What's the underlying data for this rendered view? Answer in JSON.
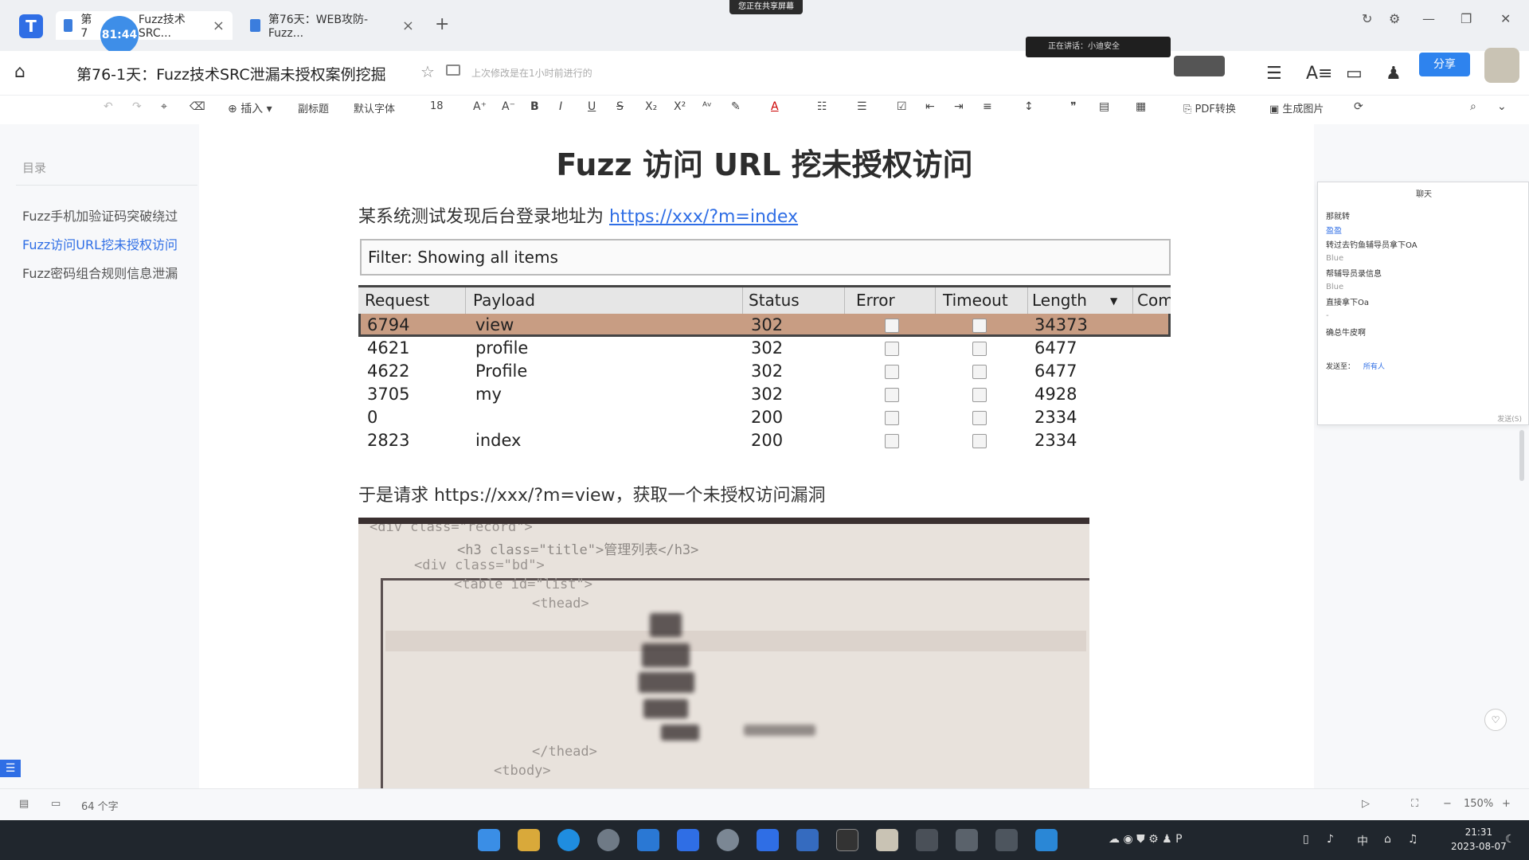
{
  "tabs": [
    {
      "label": "第7",
      "timer": "81:44",
      "label2": "Fuzz技术SRC..."
    },
    {
      "label": "第76天：WEB攻防-Fuzz..."
    }
  ],
  "share_banner": "您正在共享屏幕",
  "header": {
    "doc_title": "第76-1天：Fuzz技术SRC泄漏未授权案例挖掘",
    "save_status": "上次修改是在1小时前进行的",
    "speaker": "正在讲话：小迪安全",
    "share_label": "分享"
  },
  "toolbar": {
    "insert": "插入",
    "heading": "副标题",
    "font": "默认字体",
    "size": "18",
    "pdf": "PDF转换",
    "image": "生成图片"
  },
  "toc": {
    "title": "目录",
    "items": [
      {
        "label": "Fuzz手机加验证码突破绕过",
        "active": false
      },
      {
        "label": "Fuzz访问URL挖未授权访问",
        "active": true
      },
      {
        "label": "Fuzz密码组合规则信息泄漏",
        "active": false
      }
    ]
  },
  "doc": {
    "heading": "Fuzz 访问 URL 挖未授权访问",
    "intro_text": "某系统测试发现后台登录地址为 ",
    "intro_link": "https://xxx/?m=index",
    "result_text": "于是请求 https://xxx/?m=view，获取一个未授权访问漏洞"
  },
  "burp": {
    "filter": "Filter: Showing all items",
    "columns": [
      "Request",
      "Payload",
      "Status",
      "Error",
      "Timeout",
      "Length",
      "Com"
    ],
    "rows": [
      {
        "request": "6794",
        "payload": "view",
        "status": "302",
        "length": "34373",
        "selected": true
      },
      {
        "request": "4621",
        "payload": "profile",
        "status": "302",
        "length": "6477",
        "selected": false
      },
      {
        "request": "4622",
        "payload": "Profile",
        "status": "302",
        "length": "6477",
        "selected": false
      },
      {
        "request": "3705",
        "payload": "my",
        "status": "302",
        "length": "4928",
        "selected": false
      },
      {
        "request": "0",
        "payload": "",
        "status": "200",
        "length": "2334",
        "selected": false
      },
      {
        "request": "2823",
        "payload": "index",
        "status": "200",
        "length": "2334",
        "selected": false
      }
    ]
  },
  "code": {
    "lines": [
      "<div class=\"record\">",
      "<h3 class=\"title\">管理列表</h3>",
      "<div class=\"bd\">",
      "<table id=\"list\">",
      "<thead>",
      "</thead>",
      "<tbody>"
    ]
  },
  "chat": {
    "title": "聊天",
    "messages": [
      {
        "text": "那就转",
        "kind": "text"
      },
      {
        "text": "盈盈",
        "kind": "blue"
      },
      {
        "text": "转过去钓鱼辅导员拿下OA",
        "kind": "text"
      },
      {
        "text": "Blue",
        "kind": "name"
      },
      {
        "text": "帮辅导员录信息",
        "kind": "text"
      },
      {
        "text": "Blue",
        "kind": "name"
      },
      {
        "text": "直接拿下Oa",
        "kind": "text"
      },
      {
        "text": "-",
        "kind": "name"
      },
      {
        "text": "确总牛皮啊",
        "kind": "text"
      }
    ],
    "send_to_label": "发送至：",
    "send_to_value": "所有人",
    "send_button": "发送(S)"
  },
  "status": {
    "word_count": "64 个字",
    "zoom": "150%"
  },
  "taskbar": {
    "ime": "中",
    "time": "21:31",
    "date": "2023-08-07"
  },
  "colors": {
    "accent": "#2f6ee5",
    "selected_row": "#c89d83",
    "taskbar": "#20262d"
  }
}
